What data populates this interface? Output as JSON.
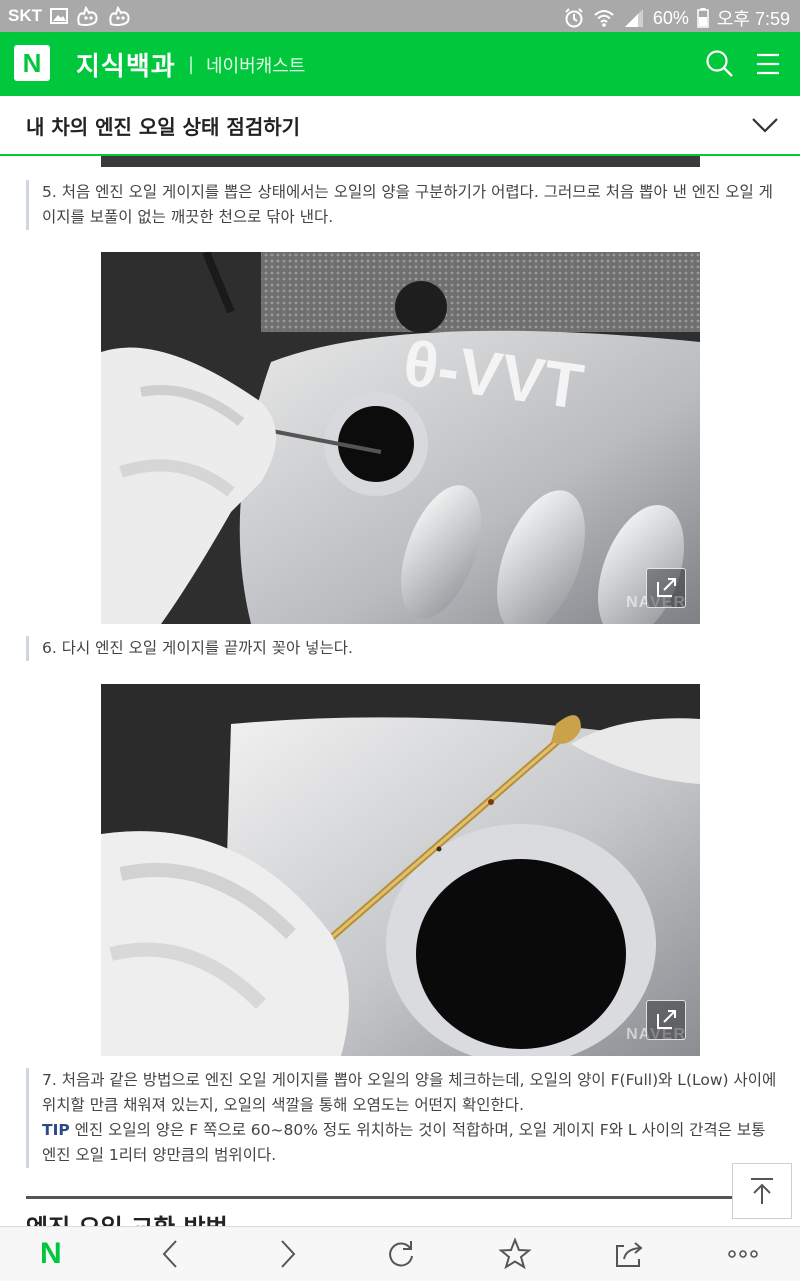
{
  "status_bar": {
    "carrier": "SKT",
    "battery": "60%",
    "time": "오후 7:59",
    "icons": [
      "image-icon",
      "cat-face-icon",
      "cat-face-icon",
      "alarm-icon",
      "wifi-icon",
      "signal-icon",
      "battery-icon"
    ]
  },
  "header": {
    "logo": "N",
    "title": "지식백과",
    "separator": "|",
    "subtitle": "네이버캐스트",
    "icons": [
      "search-icon",
      "menu-icon"
    ],
    "accent_color": "#00c73c"
  },
  "article": {
    "title": "내 차의 엔진 오일 상태 점검하기",
    "steps": [
      {
        "text": "5. 처음 엔진 오일 게이지를 뽑은 상태에서는 오일의 양을 구분하기가 어렵다. 그러므로 처음 뽑아 낸 엔진 오일 게이지를 보풀이 없는 깨끗한 천으로 닦아 낸다."
      },
      {
        "text": "6. 다시 엔진 오일 게이지를 끝까지 꽂아 넣는다."
      },
      {
        "text": "7. 처음과 같은 방법으로 엔진 오일 게이지를 뽑아 오일의 양을 체크하는데, 오일의 양이 F(Full)와 L(Low) 사이에 위치할 만큼 채워져 있는지, 오일의 색깔을 통해 오염도는 어떤지 확인한다."
      }
    ],
    "tip_label": "TIP",
    "tip_text": " 엔진 오일의 양은 F 쪽으로 60~80% 정도 위치하는 것이 적합하며, 오일 게이지 F와 L 사이의 간격은 보통 엔진 오일 1리터 양만큼의 범위이다.",
    "photo1": {
      "engine_text": "θ-VVT",
      "watermark": "NAVER"
    },
    "photo2": {
      "watermark": "NAVER"
    },
    "next_section_heading": "엔진 오일 교환 방법"
  },
  "toolbar": {
    "home_logo": "N",
    "icons": [
      "back-icon",
      "forward-icon",
      "reload-icon",
      "star-icon",
      "share-icon",
      "more-icon"
    ]
  }
}
